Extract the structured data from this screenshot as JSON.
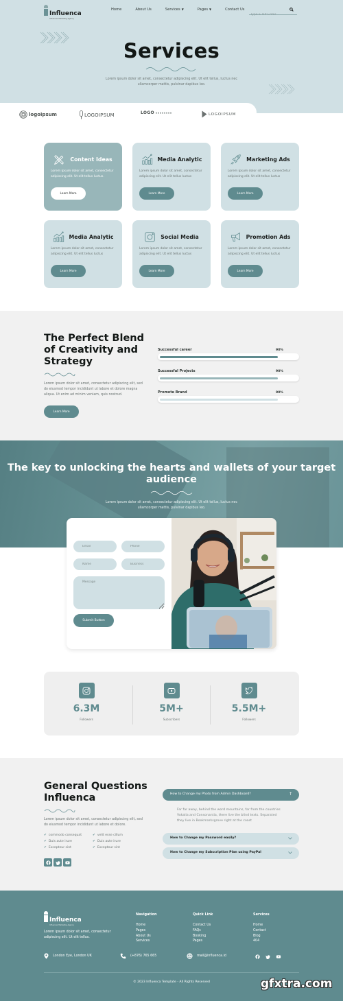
{
  "brand": {
    "name": "Influenca",
    "tagline": "Influencer Marketing Agency"
  },
  "nav": {
    "items": [
      {
        "label": "Home"
      },
      {
        "label": "About Us"
      },
      {
        "label": "Services",
        "has_dropdown": true
      },
      {
        "label": "Pages",
        "has_dropdown": true
      },
      {
        "label": "Contact Us"
      }
    ],
    "search_placeholder": "Type & Hit Enter..."
  },
  "hero": {
    "title": "Services",
    "description": "Lorem ipsum dolor sit amet, consectetur adipiscing elit. Ut elit tellus, luctus nec ullamcorper mattis, pulvinar dapibus leo."
  },
  "partner_logos": [
    {
      "name": "logoipsum",
      "icon": "concentric-circles-icon"
    },
    {
      "name": "LOGOIPSUM",
      "icon": "microphone-logo-icon"
    },
    {
      "name": "LOGO",
      "icon": "wordmark-logo"
    },
    {
      "name": "LOGOIPSUM",
      "icon": "play-logo-icon"
    }
  ],
  "services": {
    "button_label": "Learn More",
    "items": [
      {
        "title": "Content Ideas",
        "icon": "pencil-ruler-icon",
        "desc": "Lorem ipsum dolor sit amet, consectetur adipiscing elit. Ut elit tellus luctus.",
        "active": true
      },
      {
        "title": "Media Analytic",
        "icon": "analytics-chart-icon",
        "desc": "Lorem ipsum dolor sit amet, consectetur adipiscing elit. Ut elit tellus luctus",
        "active": false
      },
      {
        "title": "Marketing Ads",
        "icon": "rocket-icon",
        "desc": "Lorem ipsum dolor sit amet, consectetur adipiscing elit. Ut elit tellus luctus",
        "active": false
      },
      {
        "title": "Media Analytic",
        "icon": "analytics-chart-icon",
        "desc": "Lorem ipsum dolor sit amet, consectetur adipiscing elit. Ut elit tellus luctus",
        "active": false
      },
      {
        "title": "Social Media",
        "icon": "instagram-icon",
        "desc": "Lorem ipsum dolor sit amet, consectetur adipiscing elit. Ut elit tellus luctus",
        "active": false
      },
      {
        "title": "Promotion Ads",
        "icon": "megaphone-icon",
        "desc": "Lorem ipsum dolor sit amet, consectetur adipiscing elit. Ut elit tellus luctus",
        "active": false
      }
    ]
  },
  "blend": {
    "title": "The Perfect Blend of Creativity and Strategy",
    "description": "Lorem ipsum dolor sit amet, consectetur adipiscing elit, sed do eiusmod tempor incididunt ut labore et dolore magna aliqua. Ut enim ad minim veniam, quis nostrud.",
    "button_label": "Learn More",
    "skills": [
      {
        "label": "Successful career",
        "value_text": "90%",
        "value": 0.9,
        "color": "#5f8b8f"
      },
      {
        "label": "Successful Projects",
        "value_text": "90%",
        "value": 0.9,
        "color": "#98b6b9"
      },
      {
        "label": "Promote Brand",
        "value_text": "90%",
        "value": 0.9,
        "color": "#d0e0e4"
      }
    ]
  },
  "key": {
    "title": "The key to unlocking the hearts and wallets of your target audience",
    "description": "Lorem ipsum dolor sit amet, consectetur adipiscing elit. Ut elit tellus, luctus nec ullamcorper mattis, pulvinar dapibus leo."
  },
  "contact_form": {
    "email_placeholder": "Email",
    "phone_placeholder": "Phone",
    "name_placeholder": "Name",
    "business_placeholder": "Business",
    "message_placeholder": "Message",
    "submit_label": "Submit Button"
  },
  "stats": [
    {
      "icon": "instagram-icon",
      "value": "6.3M",
      "label": "Followers"
    },
    {
      "icon": "youtube-icon",
      "value": "5M+",
      "label": "Subscribers"
    },
    {
      "icon": "twitter-icon",
      "value": "5.5M+",
      "label": "Followers"
    }
  ],
  "faq": {
    "title": "General Questions Influenca",
    "description": "Lorem ipsum dolor sit amet, consectetur adipiscing elit, sed do eiusmod tempor incididunt ut labore et dolore.",
    "checks": [
      "commodo consequat",
      "velit esse cillum",
      "Duis aute irure",
      "Duis aute irure",
      "Excepteur sint",
      "Excepteur sint"
    ],
    "questions": [
      {
        "q": "How to Change my Photo from Admin Dashboard?",
        "open": true,
        "answer": "Far far away, behind the word mountains, far from the countries Vokalia and Consonantia, there live the blind texts. Separated they live in Bookmarksgrove right at the coast"
      },
      {
        "q": "How to Change my Password easily?",
        "open": false
      },
      {
        "q": "How to Change my Subscription Plan using PayPal",
        "open": false
      }
    ]
  },
  "footer": {
    "description": "Lorem ipsum dolor sit amet, consectetur adipiscing elit. Ut elit tellus.",
    "columns": [
      {
        "title": "Navigation",
        "links": [
          "Home",
          "Pages",
          "About Us",
          "Services"
        ]
      },
      {
        "title": "Quick Link",
        "links": [
          "Contact Us",
          "FAQs",
          "Booking",
          "Pages"
        ]
      },
      {
        "title": "Services",
        "links": [
          "Home",
          "Contact",
          "Blog",
          "404"
        ]
      }
    ],
    "address": "London Eye, London UK",
    "phone": "(+876) 765 665",
    "email": "mail@influenca.id",
    "copyright": "© 2023 Influenca Template - All Rights Reserved"
  },
  "watermark": "gfxtra.com",
  "colors": {
    "primary": "#5f8b8f",
    "light": "#d0e0e4",
    "mid": "#98b6b9",
    "section_bg": "#f1f1f1"
  }
}
